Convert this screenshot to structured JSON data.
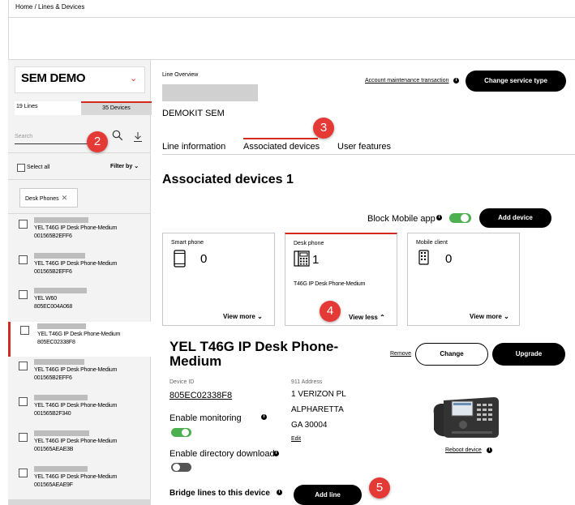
{
  "breadcrumb": "Home  /  Lines & Devices",
  "sidebar": {
    "account_name": "SEM DEMO",
    "tabs": [
      {
        "label": "19 Lines"
      },
      {
        "label": "35 Devices"
      }
    ],
    "search_placeholder": "Search",
    "select_all_label": "Select all",
    "filter_label": "Filter by",
    "filter_chip": "Desk Phones",
    "devices": [
      {
        "model": "YEL T46G IP Desk Phone-Medium",
        "mac": "001565B2EFF6"
      },
      {
        "model": "YEL T46G IP Desk Phone-Medium",
        "mac": "001565B2EFF6"
      },
      {
        "model": "YEL W60",
        "mac": "805EC004A068"
      },
      {
        "model": "YEL T46G IP Desk Phone-Medium",
        "mac": "805EC02338F8"
      },
      {
        "model": "YEL T46G IP Desk Phone-Medium",
        "mac": "001565B2EFF6"
      },
      {
        "model": "YEL T46G IP Desk Phone-Medium",
        "mac": "001565B2F340"
      },
      {
        "model": "YEL T46G IP Desk Phone-Medium",
        "mac": "001565AEAE3B"
      },
      {
        "model": "YEL T46G IP Desk Phone-Medium",
        "mac": "001565AEAE9F"
      }
    ]
  },
  "main": {
    "line_overview_label": "Line Overview",
    "account_maintenance_link": "Account maintenance transaction",
    "change_service_button": "Change service type",
    "line_name": "DEMOKIT SEM",
    "tabs": [
      {
        "label": "Line information"
      },
      {
        "label": "Associated devices"
      },
      {
        "label": "User features"
      }
    ],
    "section_title": "Associated devices 1",
    "block_mobile_label": "Block Mobile app",
    "add_device_button": "Add device",
    "cards": [
      {
        "type": "Smart phone",
        "count": "0",
        "sub": "",
        "link": "View more"
      },
      {
        "type": "Desk phone",
        "count": "1",
        "sub": "T46G IP Desk Phone-Medium",
        "link": "View less"
      },
      {
        "type": "Mobile client",
        "count": "0",
        "sub": "",
        "link": "View more"
      }
    ],
    "device_detail": {
      "title": "YEL T46G IP Desk Phone-Medium",
      "remove_link": "Remove",
      "change_button": "Change",
      "upgrade_button": "Upgrade",
      "device_id_label": "Device ID",
      "device_id_value": "805EC02338F8",
      "address_label": "911 Address",
      "address_lines": [
        "1 VERIZON PL",
        "ALPHARETTA",
        "GA  30004"
      ],
      "edit_link": "Edit",
      "enable_monitoring_label": "Enable monitoring",
      "enable_directory_label": "Enable directory download",
      "bridge_label": "Bridge lines to this device",
      "add_line_button": "Add line",
      "reboot_link": "Reboot device"
    }
  },
  "step_badges": [
    "2",
    "3",
    "4",
    "5"
  ],
  "colors": {
    "accent_red": "#d52b1e",
    "toggle_on": "#4caf50",
    "badge_red": "#e53935"
  }
}
